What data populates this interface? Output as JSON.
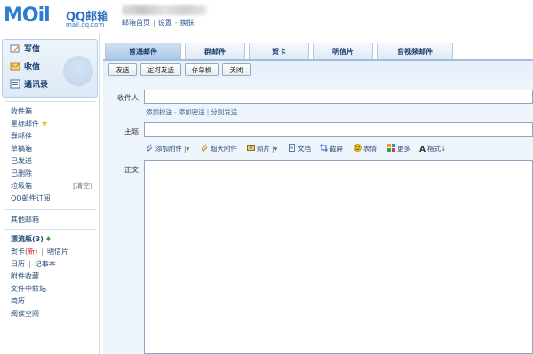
{
  "header": {
    "logo_text": "MOil",
    "logo_cn": "QQ邮箱",
    "logo_url": "mail.qq.com",
    "links": [
      "邮箱首页",
      "设置",
      "换肤"
    ]
  },
  "sidebar": {
    "main": [
      "写信",
      "收信",
      "通讯录"
    ],
    "folders": [
      "收件箱",
      "星标邮件",
      "群邮件",
      "草稿箱",
      "已发送",
      "已删除",
      "垃圾箱",
      "QQ邮件订阅"
    ],
    "clear_label": "[清空]",
    "other": "其他邮箱",
    "bottle": "漂流瓶(3)",
    "card": "贺卡",
    "card_new": "(新)",
    "postcard": "明信片",
    "calendar": "日历",
    "notes": "记事本",
    "attach": "附件收藏",
    "transfer": "文件中转站",
    "resume": "简历",
    "reading": "阅读空间"
  },
  "tabs": [
    "普通邮件",
    "群邮件",
    "贺卡",
    "明信片",
    "音视频邮件"
  ],
  "toolbar": [
    "发送",
    "定时发送",
    "存草稿",
    "关闭"
  ],
  "compose": {
    "to_label": "收件人",
    "recip_links": [
      "添加抄送",
      "添加密送",
      "分别发送"
    ],
    "subject_label": "主题",
    "body_label": "正文",
    "editor_buttons": [
      "添加附件",
      "超大附件",
      "照片",
      "文档",
      "截屏",
      "表情",
      "更多",
      "格式"
    ]
  },
  "colors": {
    "brand": "#2a7dd1",
    "link": "#2a5a96",
    "tab_active": "#a9c6e8",
    "panel": "#eef4fb"
  }
}
